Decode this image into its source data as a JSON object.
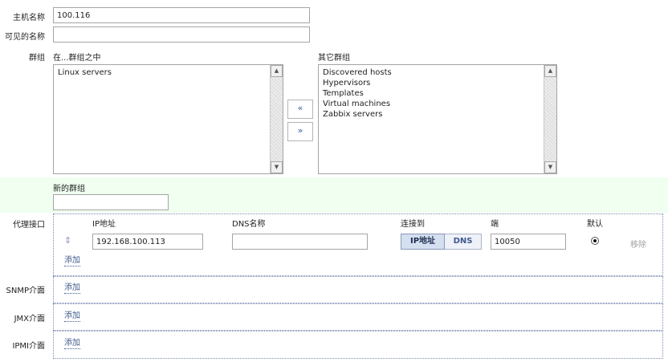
{
  "form": {
    "host_name": {
      "label": "主机名称",
      "value": "100.116"
    },
    "visible_name": {
      "label": "可见的名称",
      "value": ""
    },
    "groups": {
      "label": "群组",
      "in_groups_label": "在...群组之中",
      "other_groups_label": "其它群组",
      "in_groups": [
        "Linux servers"
      ],
      "other_groups": [
        "Discovered hosts",
        "Hypervisors",
        "Templates",
        "Virtual machines",
        "Zabbix servers"
      ],
      "move_left_label": "«",
      "move_right_label": "»"
    },
    "new_group": {
      "label": "新的群组",
      "value": ""
    },
    "agent_interfaces": {
      "label": "代理接口",
      "headers": {
        "ip": "IP地址",
        "dns": "DNS名称",
        "connect_to": "连接到",
        "port": "端",
        "default": "默认"
      },
      "row": {
        "ip": "192.168.100.113",
        "dns": "",
        "connect_ip_label": "IP地址",
        "connect_dns_label": "DNS",
        "connect_selected": "IP地址",
        "port": "10050",
        "is_default": true,
        "remove_label": "移除"
      },
      "add_label": "添加"
    },
    "snmp_interfaces": {
      "label": "SNMP介面",
      "add_label": "添加"
    },
    "jmx_interfaces": {
      "label": "JMX介面",
      "add_label": "添加"
    },
    "ipmi_interfaces": {
      "label": "IPMI介面",
      "add_label": "添加"
    }
  },
  "icons": {
    "drag": "drag-handle-icon",
    "scroll_up": "scroll-up-arrow-icon",
    "scroll_down": "scroll-down-arrow-icon"
  },
  "colors": {
    "link": "#3e5a8c",
    "new_group_bg": "#f0fff0",
    "dotted_border": "#7d8ab4",
    "selected_toggle": "#d4dff0"
  }
}
